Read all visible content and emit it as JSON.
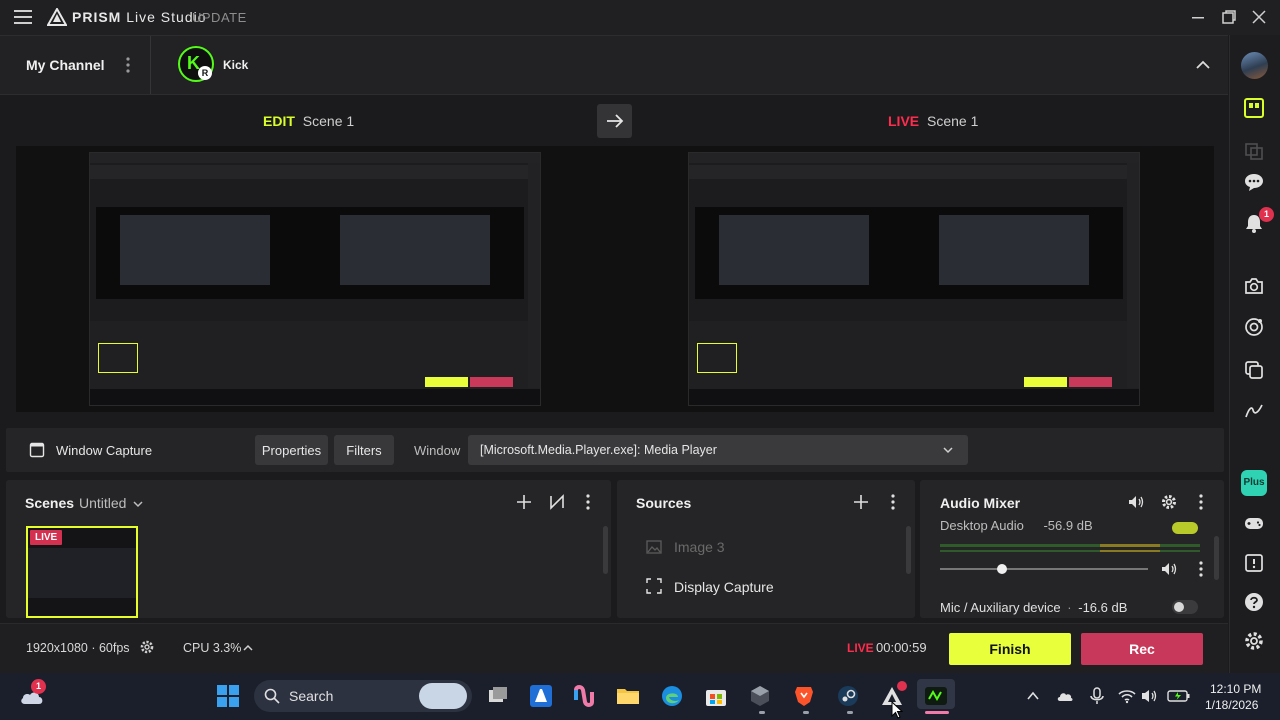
{
  "titlebar": {
    "brand": "PRISM",
    "brand_rest": "Live Studio",
    "update_label": "UPDATE"
  },
  "channel": {
    "my_channel_label": "My Channel",
    "platform_name": "Kick",
    "platform_badge": "R",
    "platform_logo": "K"
  },
  "scene_heads": {
    "edit_tag": "EDIT",
    "edit_scene": "Scene 1",
    "live_tag": "LIVE",
    "live_scene": "Scene 1"
  },
  "source_toolbar": {
    "source_name": "Window Capture",
    "properties_label": "Properties",
    "filters_label": "Filters",
    "window_label": "Window",
    "window_value": "[Microsoft.Media.Player.exe]: Media Player"
  },
  "scenes_panel": {
    "title": "Scenes",
    "collection": "Untitled",
    "live_badge": "LIVE"
  },
  "sources_panel": {
    "title": "Sources",
    "items": [
      {
        "label": "Image 3",
        "icon": "image-icon",
        "visible": false
      },
      {
        "label": "Display Capture",
        "icon": "display-capture-icon",
        "visible": true
      }
    ]
  },
  "audio_mixer": {
    "title": "Audio Mixer",
    "channels": [
      {
        "name": "Desktop Audio",
        "level": "-56.9 dB",
        "volume": 0.3,
        "enabled": true
      },
      {
        "name": "Mic / Auxiliary device",
        "level": "-16.6 dB",
        "enabled": false
      }
    ]
  },
  "statusbar": {
    "resolution": "1920x1080 · 60fps",
    "cpu": "CPU 3.3%",
    "live_label": "LIVE",
    "live_timer": "00:00:59",
    "finish_label": "Finish",
    "rec_label": "Rec"
  },
  "sidebar": {
    "notification_count": "1",
    "plus_label": "Plus"
  },
  "taskbar": {
    "search_placeholder": "Search",
    "weather_badge": "1",
    "time": "12:10 PM",
    "date": "1/18/2026"
  },
  "colors": {
    "edit_accent": "#d9ff2b",
    "live_accent": "#ff2c4d",
    "finish_button": "#e8ff3b",
    "rec_button": "#c8385a",
    "kick_green": "#53fc18"
  }
}
